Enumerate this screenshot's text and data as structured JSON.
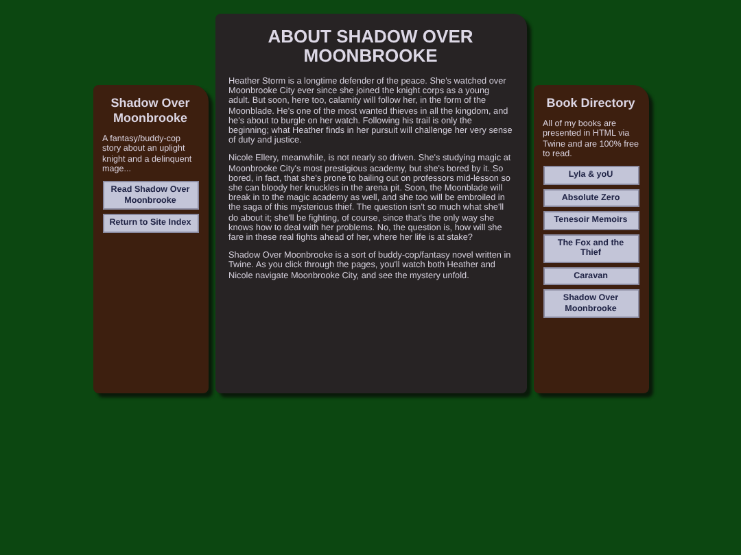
{
  "left_panel": {
    "title": "Shadow Over Moonbrooke",
    "description": "A fantasy/buddy-cop story about an uplight knight and a delinquent mage...",
    "buttons": [
      "Read Shadow Over Moonbrooke",
      "Return to Site Index"
    ]
  },
  "main": {
    "title": "ABOUT SHADOW OVER MOONBROOKE",
    "paragraphs": [
      "Heather Storm is a longtime defender of the peace. She's watched over Moonbrooke City ever since she joined the knight corps as a young adult. But soon, here too, calamity will follow her, in the form of the Moonblade. He's one of the most wanted thieves in all the kingdom, and he's about to burgle on her watch. Following his trail is only the beginning; what Heather finds in her pursuit will challenge her very sense of duty and justice.",
      "Nicole Ellery, meanwhile, is not nearly so driven. She's studying magic at Moonbrooke City's most prestigious academy, but she's bored by it. So bored, in fact, that she's prone to bailing out on professors mid-lesson so she can bloody her knuckles in the arena pit. Soon, the Moonblade will break in to the magic academy as well, and she too will be embroiled in the saga of this mysterious thief. The question isn't so much what she'll do about it; she'll be fighting, of course, since that's the only way she knows how to deal with her problems. No, the question is, how will she fare in these real fights ahead of her, where her life is at stake?",
      "Shadow Over Moonbrooke is a sort of buddy-cop/fantasy novel written in Twine. As you click through the pages, you'll watch both Heather and Nicole navigate Moonbrooke City, and see the mystery unfold."
    ]
  },
  "right_panel": {
    "title": "Book Directory",
    "description": "All of my books are presented in HTML via Twine and are 100% free to read.",
    "buttons": [
      "Lyla & yoU",
      "Absolute Zero",
      "Tenesoir Memoirs",
      "The Fox and the Thief",
      "Caravan",
      "Shadow Over Moonbrooke"
    ]
  }
}
